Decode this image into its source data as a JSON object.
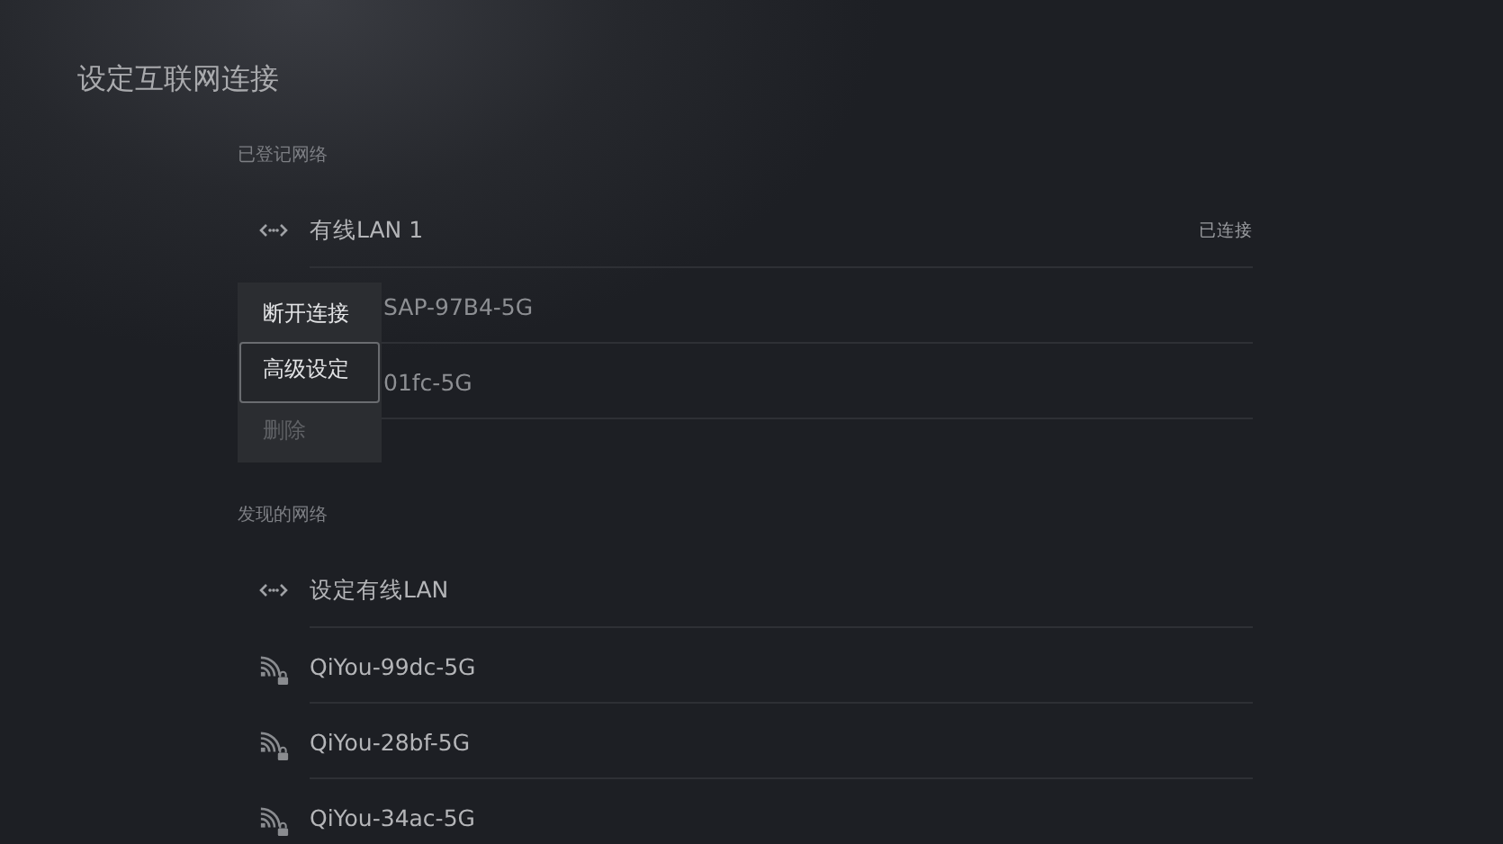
{
  "title": "设定互联网连接",
  "sections": [
    {
      "label": "已登记网络",
      "rows": [
        {
          "kind": "wired",
          "name": "有线LAN 1",
          "status": "已连接"
        },
        {
          "kind": "partial",
          "name": "SAP-97B4-5G"
        },
        {
          "kind": "partial",
          "name": "01fc-5G"
        }
      ]
    },
    {
      "label": "发现的网络",
      "rows": [
        {
          "kind": "wired",
          "name": "设定有线LAN"
        },
        {
          "kind": "wifi_locked",
          "name": "QiYou-99dc-5G"
        },
        {
          "kind": "wifi_locked",
          "name": "QiYou-28bf-5G"
        },
        {
          "kind": "wifi_locked",
          "name": "QiYou-34ac-5G"
        }
      ]
    }
  ],
  "menu": {
    "items": [
      {
        "label": "断开连接",
        "selected": false,
        "disabled": false
      },
      {
        "label": "高级设定",
        "selected": true,
        "disabled": false
      },
      {
        "label": "删除",
        "selected": false,
        "disabled": true
      }
    ]
  }
}
